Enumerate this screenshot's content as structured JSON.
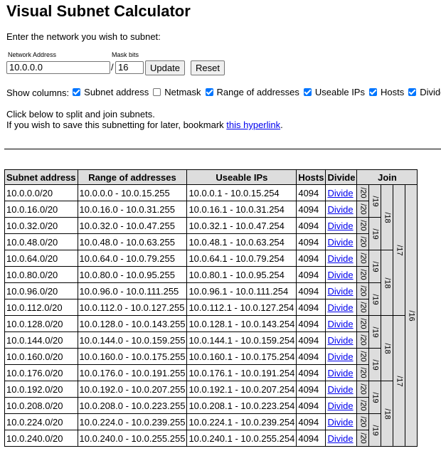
{
  "title": "Visual Subnet Calculator",
  "instruction": "Enter the network you wish to subnet:",
  "network_label": "Network Address",
  "network_value": "10.0.0.0",
  "mask_label": "Mask bits",
  "mask_value": "16",
  "slash": "/",
  "update_label": "Update",
  "reset_label": "Reset",
  "show_columns_label": "Show columns:",
  "columns": [
    {
      "label": "Subnet address",
      "checked": true
    },
    {
      "label": "Netmask",
      "checked": false
    },
    {
      "label": "Range of addresses",
      "checked": true
    },
    {
      "label": "Useable IPs",
      "checked": true
    },
    {
      "label": "Hosts",
      "checked": true
    },
    {
      "label": "Divide",
      "checked": true
    },
    {
      "label": "",
      "checked": true
    }
  ],
  "help_line1": "Click below to split and join subnets.",
  "help_line2_prefix": "If you wish to save this subnetting for later, bookmark ",
  "help_link": "this hyperlink",
  "help_line2_suffix": ".",
  "headers": {
    "subnet": "Subnet address",
    "range": "Range of addresses",
    "useable": "Useable IPs",
    "hosts": "Hosts",
    "divide": "Divide",
    "join": "Join"
  },
  "rows": [
    {
      "subnet": "10.0.0.0/20",
      "range": "10.0.0.0 - 10.0.15.255",
      "useable": "10.0.0.1 - 10.0.15.254",
      "hosts": "4094",
      "divide": "Divide"
    },
    {
      "subnet": "10.0.16.0/20",
      "range": "10.0.16.0 - 10.0.31.255",
      "useable": "10.0.16.1 - 10.0.31.254",
      "hosts": "4094",
      "divide": "Divide"
    },
    {
      "subnet": "10.0.32.0/20",
      "range": "10.0.32.0 - 10.0.47.255",
      "useable": "10.0.32.1 - 10.0.47.254",
      "hosts": "4094",
      "divide": "Divide"
    },
    {
      "subnet": "10.0.48.0/20",
      "range": "10.0.48.0 - 10.0.63.255",
      "useable": "10.0.48.1 - 10.0.63.254",
      "hosts": "4094",
      "divide": "Divide"
    },
    {
      "subnet": "10.0.64.0/20",
      "range": "10.0.64.0 - 10.0.79.255",
      "useable": "10.0.64.1 - 10.0.79.254",
      "hosts": "4094",
      "divide": "Divide"
    },
    {
      "subnet": "10.0.80.0/20",
      "range": "10.0.80.0 - 10.0.95.255",
      "useable": "10.0.80.1 - 10.0.95.254",
      "hosts": "4094",
      "divide": "Divide"
    },
    {
      "subnet": "10.0.96.0/20",
      "range": "10.0.96.0 - 10.0.111.255",
      "useable": "10.0.96.1 - 10.0.111.254",
      "hosts": "4094",
      "divide": "Divide"
    },
    {
      "subnet": "10.0.112.0/20",
      "range": "10.0.112.0 - 10.0.127.255",
      "useable": "10.0.112.1 - 10.0.127.254",
      "hosts": "4094",
      "divide": "Divide"
    },
    {
      "subnet": "10.0.128.0/20",
      "range": "10.0.128.0 - 10.0.143.255",
      "useable": "10.0.128.1 - 10.0.143.254",
      "hosts": "4094",
      "divide": "Divide"
    },
    {
      "subnet": "10.0.144.0/20",
      "range": "10.0.144.0 - 10.0.159.255",
      "useable": "10.0.144.1 - 10.0.159.254",
      "hosts": "4094",
      "divide": "Divide"
    },
    {
      "subnet": "10.0.160.0/20",
      "range": "10.0.160.0 - 10.0.175.255",
      "useable": "10.0.160.1 - 10.0.175.254",
      "hosts": "4094",
      "divide": "Divide"
    },
    {
      "subnet": "10.0.176.0/20",
      "range": "10.0.176.0 - 10.0.191.255",
      "useable": "10.0.176.1 - 10.0.191.254",
      "hosts": "4094",
      "divide": "Divide"
    },
    {
      "subnet": "10.0.192.0/20",
      "range": "10.0.192.0 - 10.0.207.255",
      "useable": "10.0.192.1 - 10.0.207.254",
      "hosts": "4094",
      "divide": "Divide"
    },
    {
      "subnet": "10.0.208.0/20",
      "range": "10.0.208.0 - 10.0.223.255",
      "useable": "10.0.208.1 - 10.0.223.254",
      "hosts": "4094",
      "divide": "Divide"
    },
    {
      "subnet": "10.0.224.0/20",
      "range": "10.0.224.0 - 10.0.239.255",
      "useable": "10.0.224.1 - 10.0.239.254",
      "hosts": "4094",
      "divide": "Divide"
    },
    {
      "subnet": "10.0.240.0/20",
      "range": "10.0.240.0 - 10.0.255.255",
      "useable": "10.0.240.1 - 10.0.255.254",
      "hosts": "4094",
      "divide": "Divide"
    }
  ],
  "join_levels": [
    {
      "label": "/20",
      "span": 1
    },
    {
      "label": "/19",
      "span": 2
    },
    {
      "label": "/18",
      "span": 4
    },
    {
      "label": "/17",
      "span": 8
    },
    {
      "label": "/16",
      "span": 16
    }
  ]
}
